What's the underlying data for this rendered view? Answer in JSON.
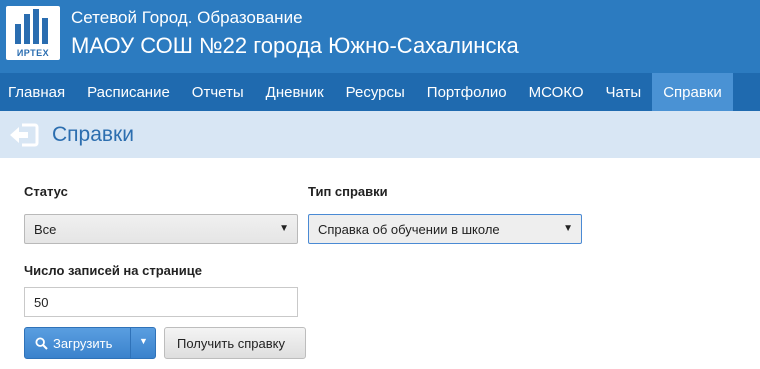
{
  "header": {
    "logo_text": "ИРТЕХ",
    "system_name": "Сетевой Город. Образование",
    "school_name": "МАОУ СОШ №22 города Южно-Сахалинска"
  },
  "nav": {
    "items": [
      {
        "label": "Главная"
      },
      {
        "label": "Расписание"
      },
      {
        "label": "Отчеты"
      },
      {
        "label": "Дневник"
      },
      {
        "label": "Ресурсы"
      },
      {
        "label": "Портфолио"
      },
      {
        "label": "МСОКО"
      },
      {
        "label": "Чаты"
      },
      {
        "label": "Справки",
        "active": true
      }
    ]
  },
  "page": {
    "title": "Справки",
    "back_icon": "arrow-left-icon"
  },
  "form": {
    "status": {
      "label": "Статус",
      "value": "Все"
    },
    "type": {
      "label": "Тип справки",
      "value": "Справка об обучении в школе"
    },
    "per_page": {
      "label": "Число записей на странице",
      "value": "50"
    }
  },
  "actions": {
    "load_label": "Загрузить",
    "get_certificate_label": "Получить справку"
  },
  "colors": {
    "header_bg": "#2c7bc0",
    "nav_bg": "#1f6aaf",
    "nav_active_bg": "#4a92d4",
    "title_bar_bg": "#d8e6f4",
    "primary_button": "#3a82cc"
  }
}
